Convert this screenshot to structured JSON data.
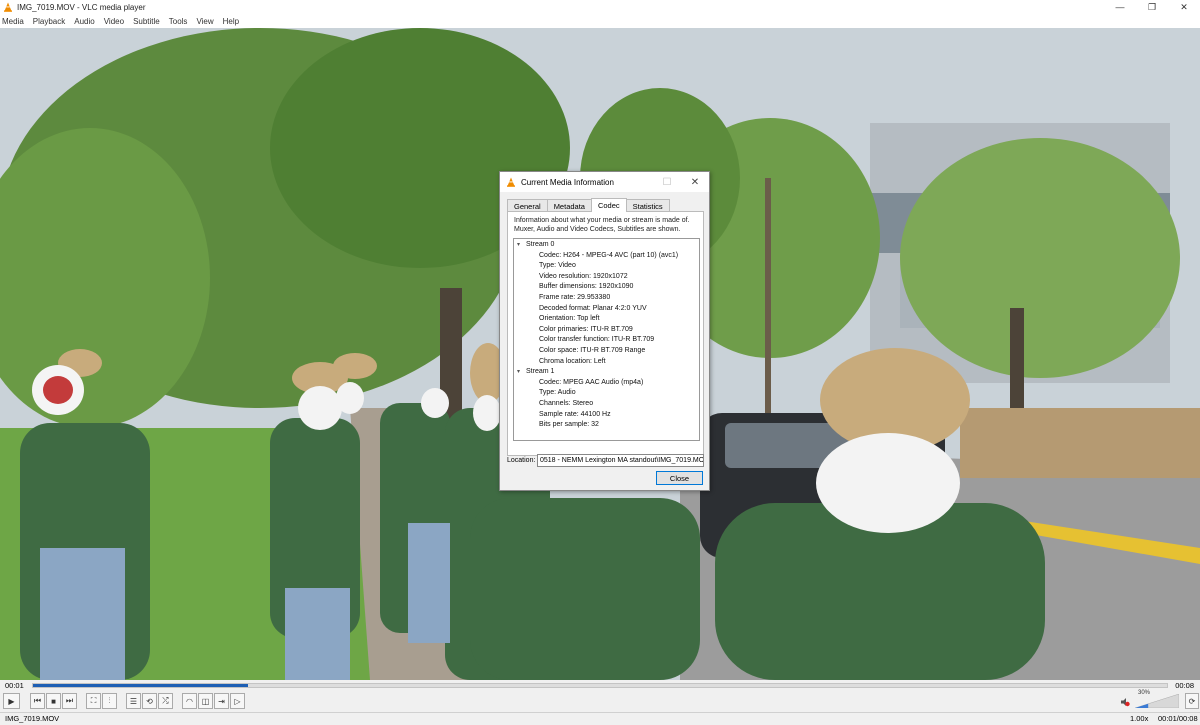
{
  "window": {
    "title": "IMG_7019.MOV - VLC media player"
  },
  "menu": [
    "Media",
    "Playback",
    "Audio",
    "Video",
    "Subtitle",
    "Tools",
    "View",
    "Help"
  ],
  "dialog": {
    "title": "Current Media Information",
    "tabs": [
      "General",
      "Metadata",
      "Codec",
      "Statistics"
    ],
    "active_tab": "Codec",
    "info": "Information about what your media or stream is made of. Muxer, Audio and Video Codecs, Subtitles are shown.",
    "streams": [
      {
        "label": "Stream 0",
        "items": [
          "Codec: H264 - MPEG-4 AVC (part 10) (avc1)",
          "Type: Video",
          "Video resolution: 1920x1072",
          "Buffer dimensions: 1920x1090",
          "Frame rate: 29.953380",
          "Decoded format: Planar 4:2:0 YUV",
          "Orientation: Top left",
          "Color primaries: ITU-R BT.709",
          "Color transfer function: ITU-R BT.709",
          "Color space: ITU-R BT.709 Range",
          "Chroma location: Left"
        ]
      },
      {
        "label": "Stream 1",
        "items": [
          "Codec: MPEG AAC Audio (mp4a)",
          "Type: Audio",
          "Channels: Stereo",
          "Sample rate: 44100 Hz",
          "Bits per sample: 32"
        ]
      }
    ],
    "location_label": "Location:",
    "location_value": "0518 - NEMM Lexington MA standout\\IMG_7019.MOV",
    "close_label": "Close"
  },
  "playback": {
    "elapsed": "00:01",
    "total": "00:08",
    "progress": 0.19,
    "volume_label": "30%",
    "volume": 0.3
  },
  "status": {
    "file": "IMG_7019.MOV",
    "rate": "1.00x",
    "time": "00:01/00:08"
  },
  "colors": {
    "accent": "#1e5fb4",
    "vlc_orange": "#f08c00"
  }
}
